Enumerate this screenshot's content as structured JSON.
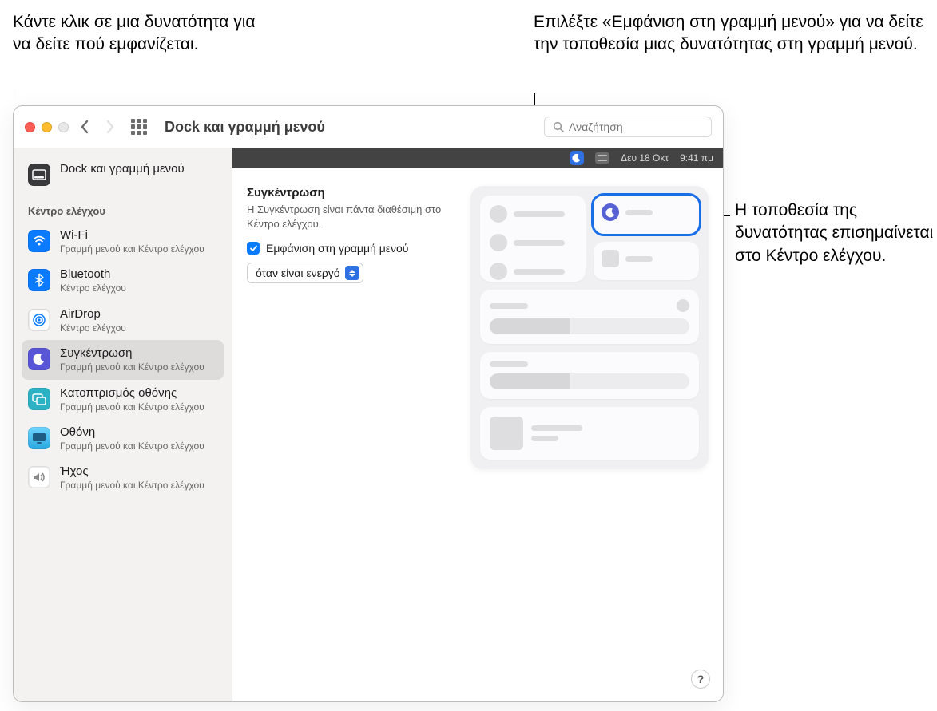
{
  "callouts": {
    "left": "Κάντε κλικ σε μια δυνατότητα για να δείτε πού εμφανίζεται.",
    "top_right": "Επιλέξτε «Εμφάνιση στη γραμμή μενού» για να δείτε την τοποθεσία μιας δυνατότητας στη γραμμή μενού.",
    "right": "Η τοποθεσία της δυνατότητας επισημαίνεται στο Κέντρο ελέγχου."
  },
  "window": {
    "title": "Dock και γραμμή μενού",
    "search_placeholder": "Αναζήτηση"
  },
  "menubar": {
    "date": "Δευ 18 Οκτ",
    "time": "9:41 πμ"
  },
  "sidebar": {
    "top_item": {
      "title": "Dock και γραμμή μενού"
    },
    "section_label": "Κέντρο ελέγχου",
    "items": [
      {
        "title": "Wi-Fi",
        "sub": "Γραμμή μενού και Κέντρο ελέγχου"
      },
      {
        "title": "Bluetooth",
        "sub": "Κέντρο ελέγχου"
      },
      {
        "title": "AirDrop",
        "sub": "Κέντρο ελέγχου"
      },
      {
        "title": "Συγκέντρωση",
        "sub": "Γραμμή μενού και Κέντρο ελέγχου"
      },
      {
        "title": "Κατοπτρισμός οθόνης",
        "sub": "Γραμμή μενού και Κέντρο ελέγχου"
      },
      {
        "title": "Οθόνη",
        "sub": "Γραμμή μενού και Κέντρο ελέγχου"
      },
      {
        "title": "Ήχος",
        "sub": "Γραμμή μενού και Κέντρο ελέγχου"
      }
    ]
  },
  "detail": {
    "title": "Συγκέντρωση",
    "desc": "Η Συγκέντρωση είναι πάντα διαθέσιμη στο Κέντρο ελέγχου.",
    "checkbox_label": "Εμφάνιση στη γραμμή μενού",
    "select_value": "όταν είναι ενεργό"
  },
  "help_label": "?"
}
